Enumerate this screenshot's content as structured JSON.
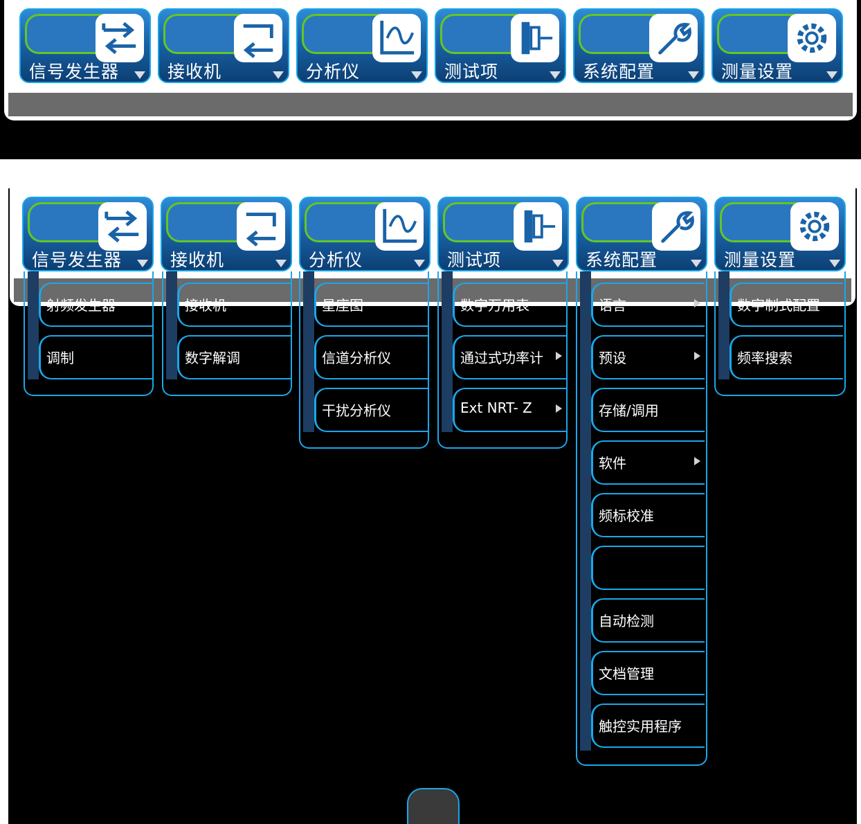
{
  "top_bar": {
    "tiles": [
      {
        "label": "信号发生器",
        "icon": "arrows-icon"
      },
      {
        "label": "接收机",
        "icon": "return-arrows-icon"
      },
      {
        "label": "分析仪",
        "icon": "waveform-icon"
      },
      {
        "label": "测试项",
        "icon": "probe-icon"
      },
      {
        "label": "系统配置",
        "icon": "wrench-icon"
      },
      {
        "label": "测量设置",
        "icon": "gear-icon"
      }
    ]
  },
  "menus": {
    "signal_generator": [
      {
        "label": "射频发生器"
      },
      {
        "label": "调制"
      }
    ],
    "receiver": [
      {
        "label": "接收机"
      },
      {
        "label": "数字解调"
      }
    ],
    "analyzer": [
      {
        "label": "星座图"
      },
      {
        "label": "信道分析仪"
      },
      {
        "label": "干扰分析仪"
      }
    ],
    "test_items": [
      {
        "label": "数字万用表"
      },
      {
        "label": "通过式功率计",
        "submenu": true
      },
      {
        "label": "Ext NRT- Z",
        "submenu": true
      }
    ],
    "system_config": [
      {
        "label": "语言",
        "submenu": true
      },
      {
        "label": "预设",
        "submenu": true
      },
      {
        "label": "存储/调用"
      },
      {
        "label": "软件",
        "submenu": true
      },
      {
        "label": "频标校准"
      },
      {
        "label": ""
      },
      {
        "label": "自动检测"
      },
      {
        "label": "文档管理"
      },
      {
        "label": "触控实用程序"
      }
    ],
    "measurement_settings": [
      {
        "label": "数字制式配置"
      },
      {
        "label": "频率搜索"
      }
    ]
  },
  "colors": {
    "accent": "#1aa7ea",
    "tile_blue": "#1a63a8",
    "pill_green": "#64c722",
    "background": "#000000"
  }
}
